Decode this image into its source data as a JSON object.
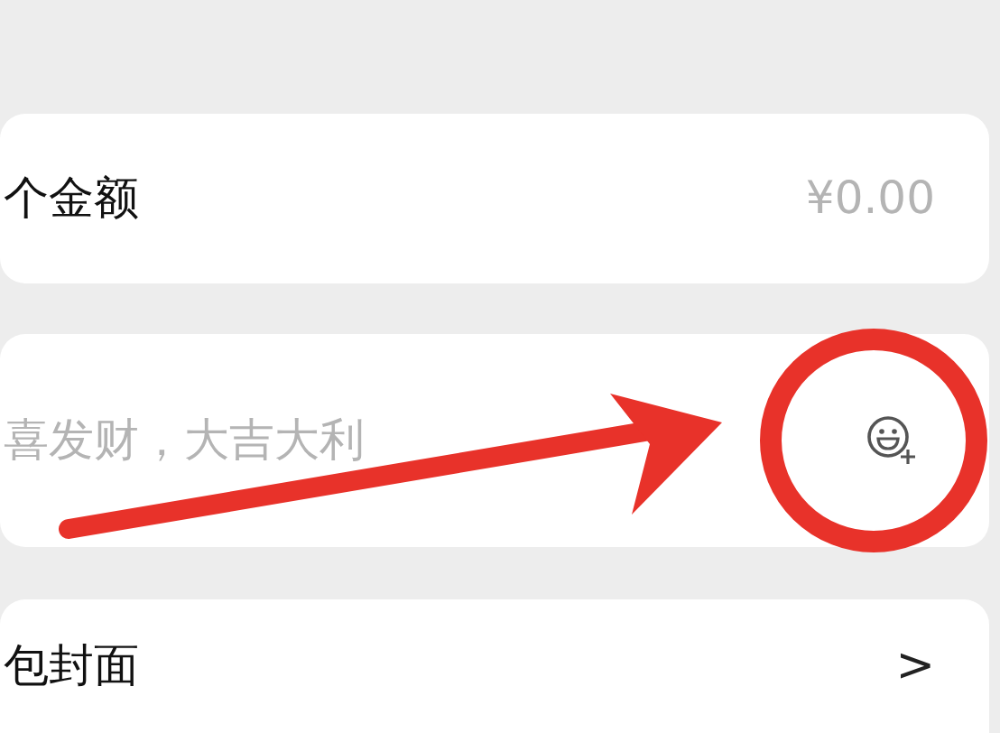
{
  "amount_row": {
    "label": "个金额",
    "value": "¥0.00"
  },
  "greeting_row": {
    "placeholder": "喜发财，大吉大利"
  },
  "cover_row": {
    "label": "包封面",
    "chevron": ">"
  },
  "annotation_arrow": {
    "color": "#e8322a"
  },
  "annotation_circle": {
    "color": "#e8322a"
  }
}
